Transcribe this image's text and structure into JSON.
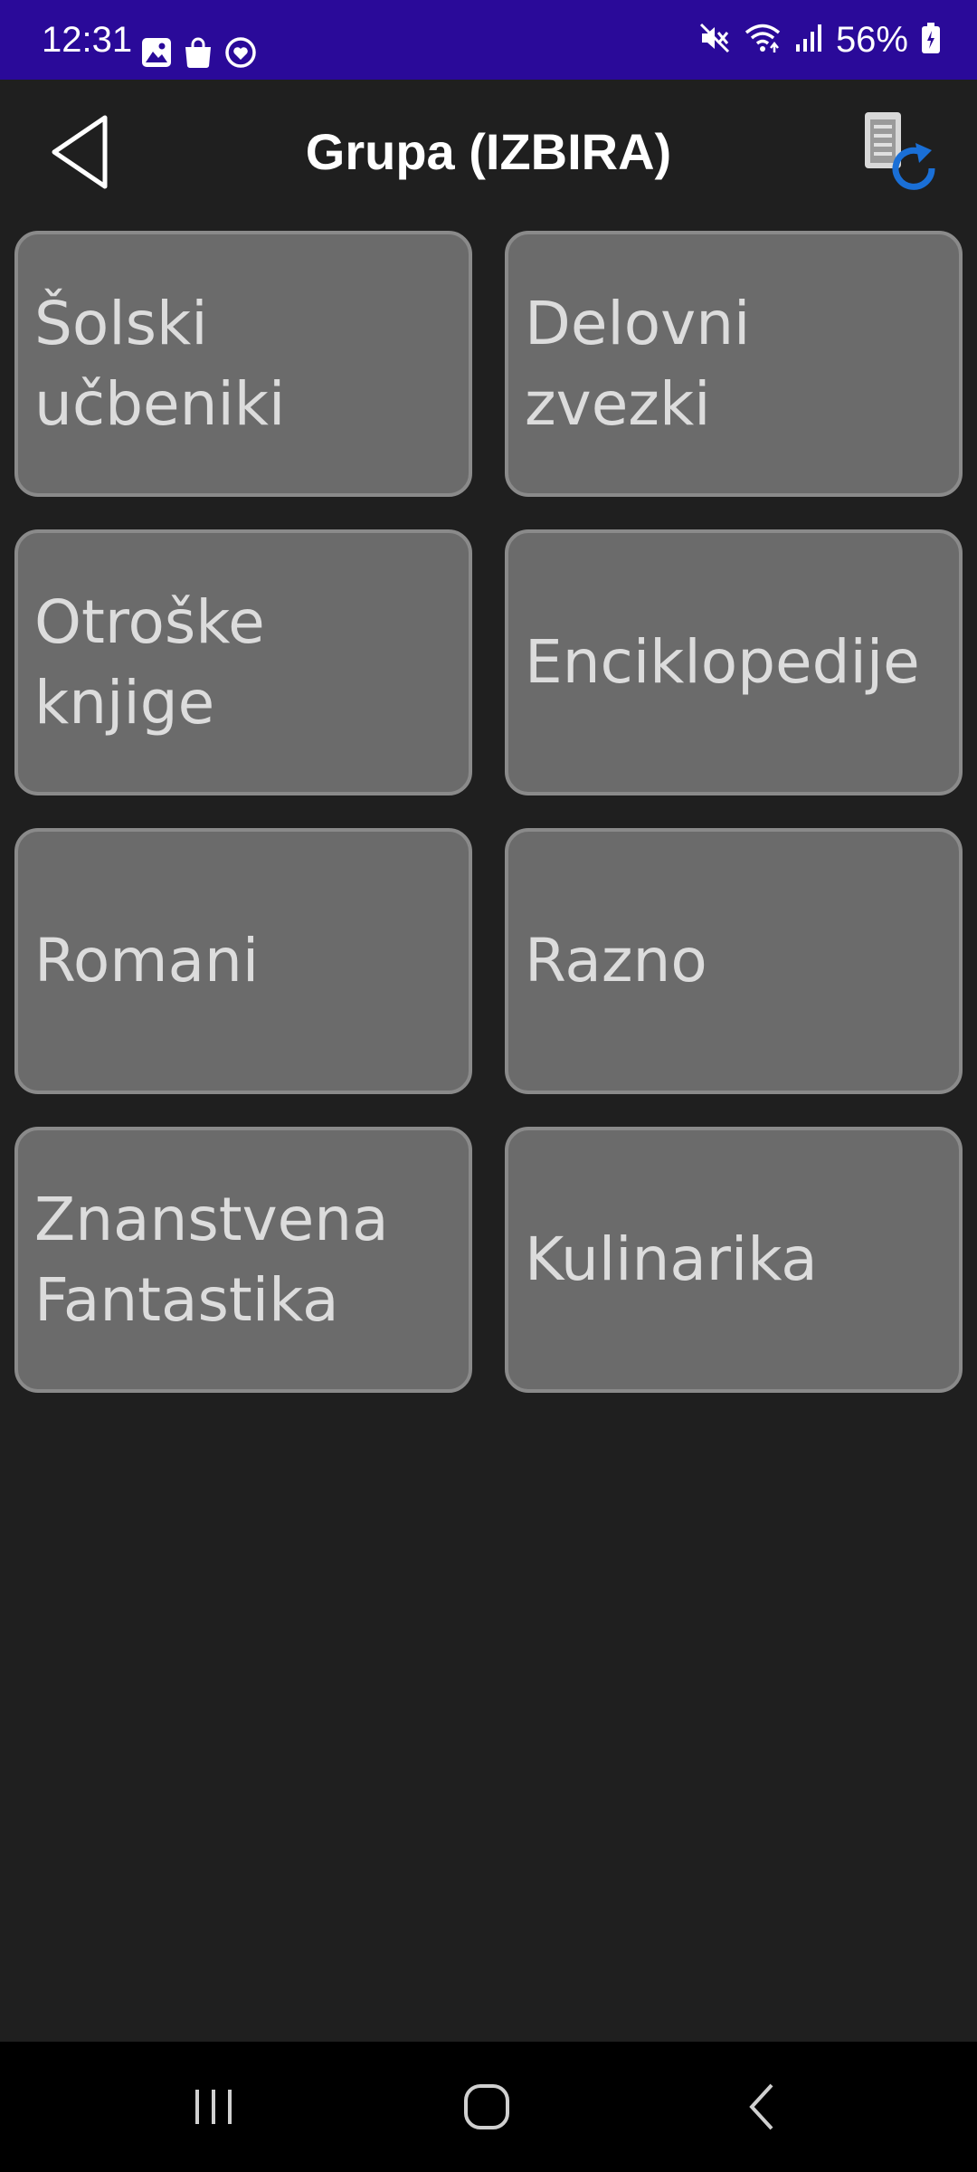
{
  "status_bar": {
    "time": "12:31",
    "battery": "56%",
    "left_icons": [
      "gallery-icon",
      "shopping-bag-icon",
      "heart-badge-icon"
    ],
    "right_icons": [
      "mute-icon",
      "wifi-icon",
      "signal-icon",
      "battery-icon"
    ],
    "background_color": "#2a0a99"
  },
  "header": {
    "title": "Grupa (IZBIRA)",
    "back_icon": "back-triangle-icon",
    "sync_icon": "document-sync-icon"
  },
  "groups": [
    {
      "label": "Šolski učbeniki"
    },
    {
      "label": "Delovni zvezki"
    },
    {
      "label": "Otroške knjige"
    },
    {
      "label": "Enciklopedije"
    },
    {
      "label": "Romani"
    },
    {
      "label": "Razno"
    },
    {
      "label": "Znanstvena Fantastika"
    },
    {
      "label": "Kulinarika"
    }
  ],
  "nav_bar": {
    "recents_icon": "recents-icon",
    "home_icon": "home-icon",
    "back_icon": "nav-back-icon"
  },
  "colors": {
    "background": "#1f1f1f",
    "tile": "#6b6b6b",
    "tile_border": "#8a8a8a",
    "tile_text": "#dcdcdc",
    "accent_blue": "#1a6fd6"
  }
}
